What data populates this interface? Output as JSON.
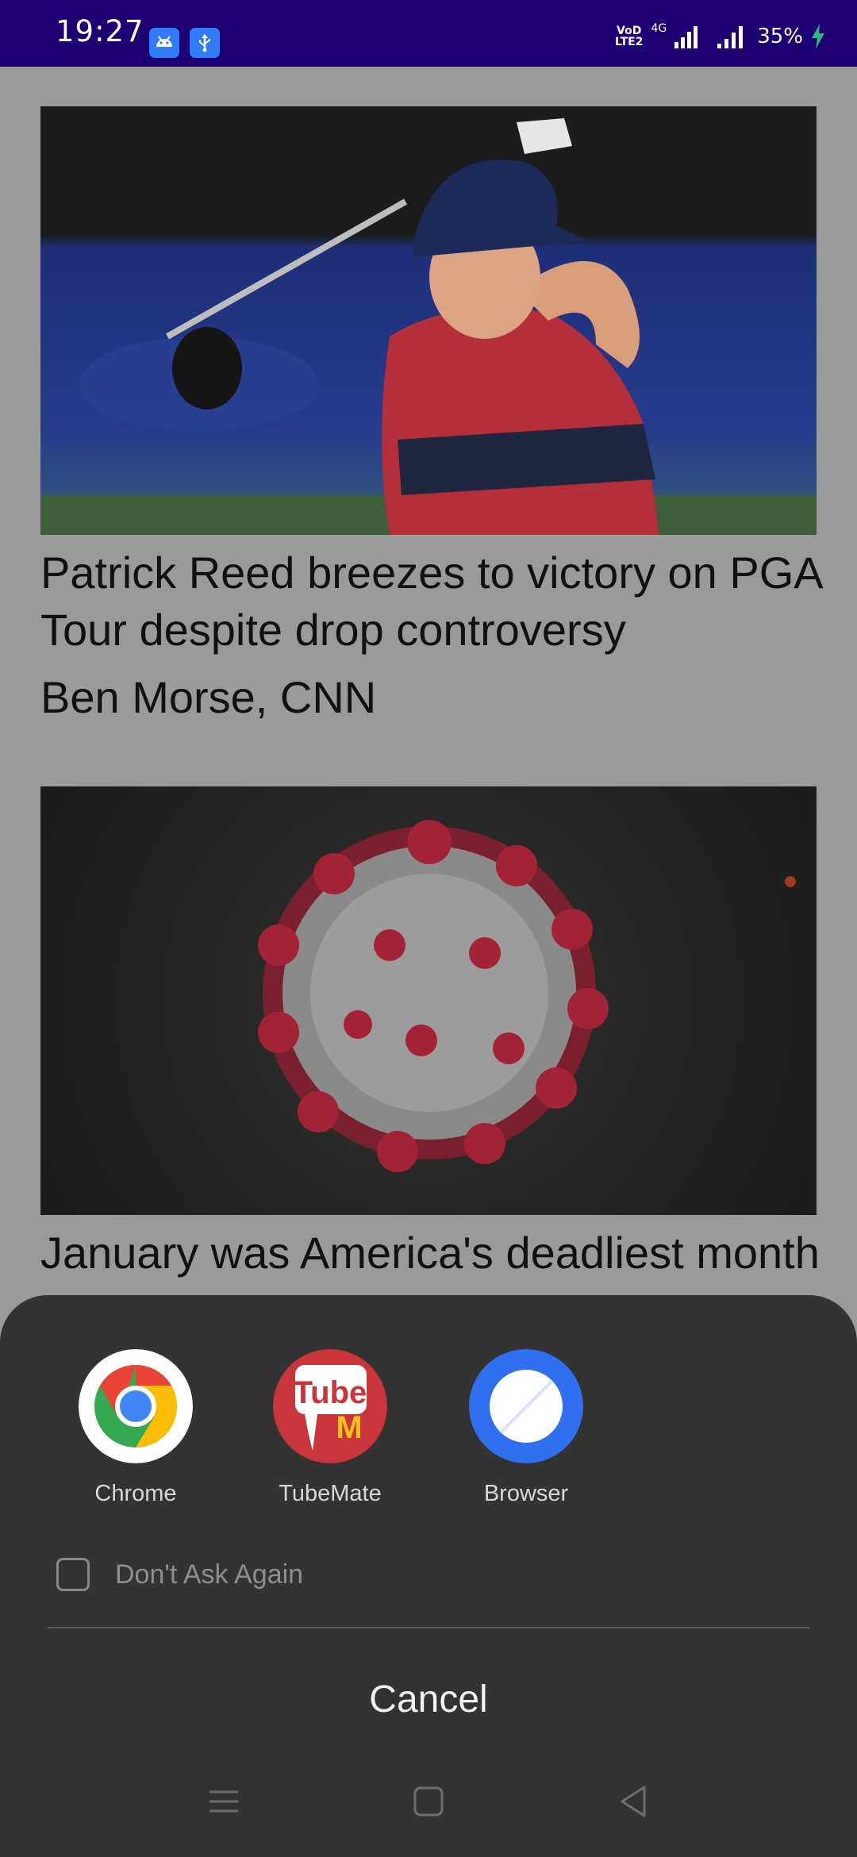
{
  "status_bar": {
    "time": "19:27",
    "volte_line1": "VoD",
    "volte_line2": "LTE2",
    "network": "4G",
    "battery": "35%"
  },
  "feed": {
    "articles": [
      {
        "headline": "Patrick Reed breezes to victory on PGA Tour despite drop controversy",
        "byline": "Ben Morse, CNN"
      },
      {
        "headline": "January was America's deadliest month"
      }
    ]
  },
  "chooser": {
    "apps": [
      {
        "label": "Chrome",
        "icon": "chrome-icon"
      },
      {
        "label": "TubeMate",
        "icon": "tubemate-icon"
      },
      {
        "label": "Browser",
        "icon": "browser-icon"
      }
    ],
    "tubemate_logo_text": "Tube",
    "tubemate_logo_mark": "M",
    "dont_ask_again": "Don't Ask Again",
    "cancel": "Cancel"
  },
  "nav_bar": {
    "icons": [
      "menu-icon",
      "home-icon",
      "back-icon"
    ]
  }
}
